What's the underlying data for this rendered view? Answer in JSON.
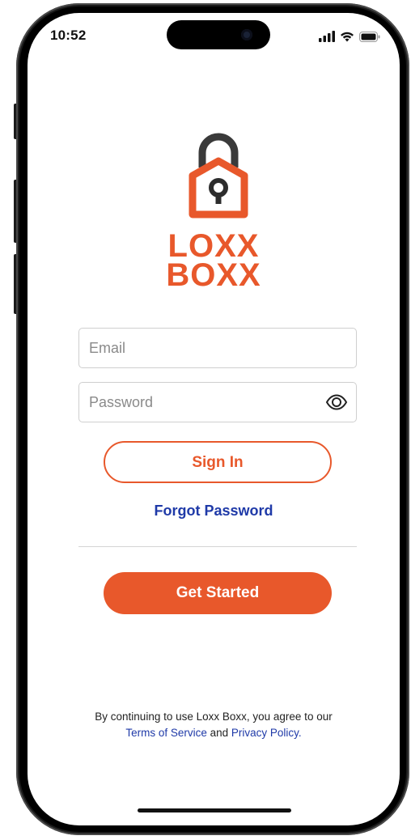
{
  "status_bar": {
    "time": "10:52",
    "icons": [
      "signal-icon",
      "wifi-icon",
      "battery-icon"
    ]
  },
  "brand": {
    "line1": "LOXX",
    "line2": "BOXX",
    "color": "#e8582b",
    "logo_icon": "padlock-house-icon"
  },
  "form": {
    "email_placeholder": "Email",
    "email_value": "",
    "password_placeholder": "Password",
    "password_value": "",
    "password_toggle_icon": "eye-icon"
  },
  "actions": {
    "sign_in_label": "Sign In",
    "forgot_password_label": "Forgot Password",
    "get_started_label": "Get Started"
  },
  "legal": {
    "prefix": "By continuing to use Loxx Boxx, you agree to our",
    "terms_label": "Terms of Service",
    "and_text": " and ",
    "privacy_label": "Privacy Policy."
  },
  "colors": {
    "accent": "#e8582b",
    "link": "#1f3aa8"
  }
}
